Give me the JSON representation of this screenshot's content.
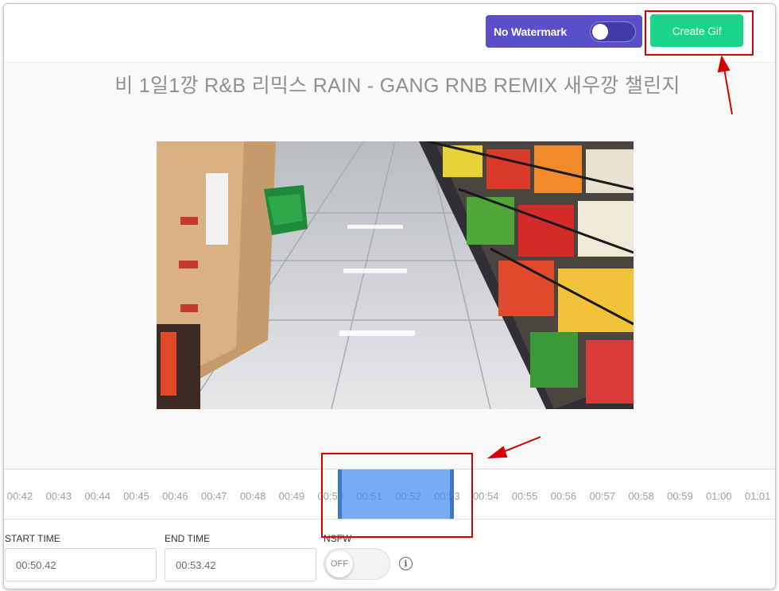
{
  "header": {
    "watermark_label": "No Watermark",
    "watermark_enabled": true,
    "create_label": "Create Gif"
  },
  "video": {
    "title": "비 1일1깡 R&B 리믹스 RAIN - GANG RNB REMIX 새우깡 챌린지"
  },
  "timeline": {
    "ticks": [
      "00:42",
      "00:43",
      "00:44",
      "00:45",
      "00:46",
      "00:47",
      "00:48",
      "00:49",
      "00:50",
      "00:51",
      "00:52",
      "00:53",
      "00:54",
      "00:55",
      "00:56",
      "00:57",
      "00:58",
      "00:59",
      "01:00",
      "01:01"
    ]
  },
  "form": {
    "start_label": "START TIME",
    "start_value": "00:50.42",
    "end_label": "END TIME",
    "end_value": "00:53.42",
    "nsfw_label": "NSFW",
    "nsfw_state": "OFF",
    "info_glyph": "i"
  },
  "colors": {
    "watermark_bg": "#5b4fc9",
    "create_bg": "#19d48a",
    "selection": "#4a8ff0",
    "annotation": "#d40000"
  }
}
